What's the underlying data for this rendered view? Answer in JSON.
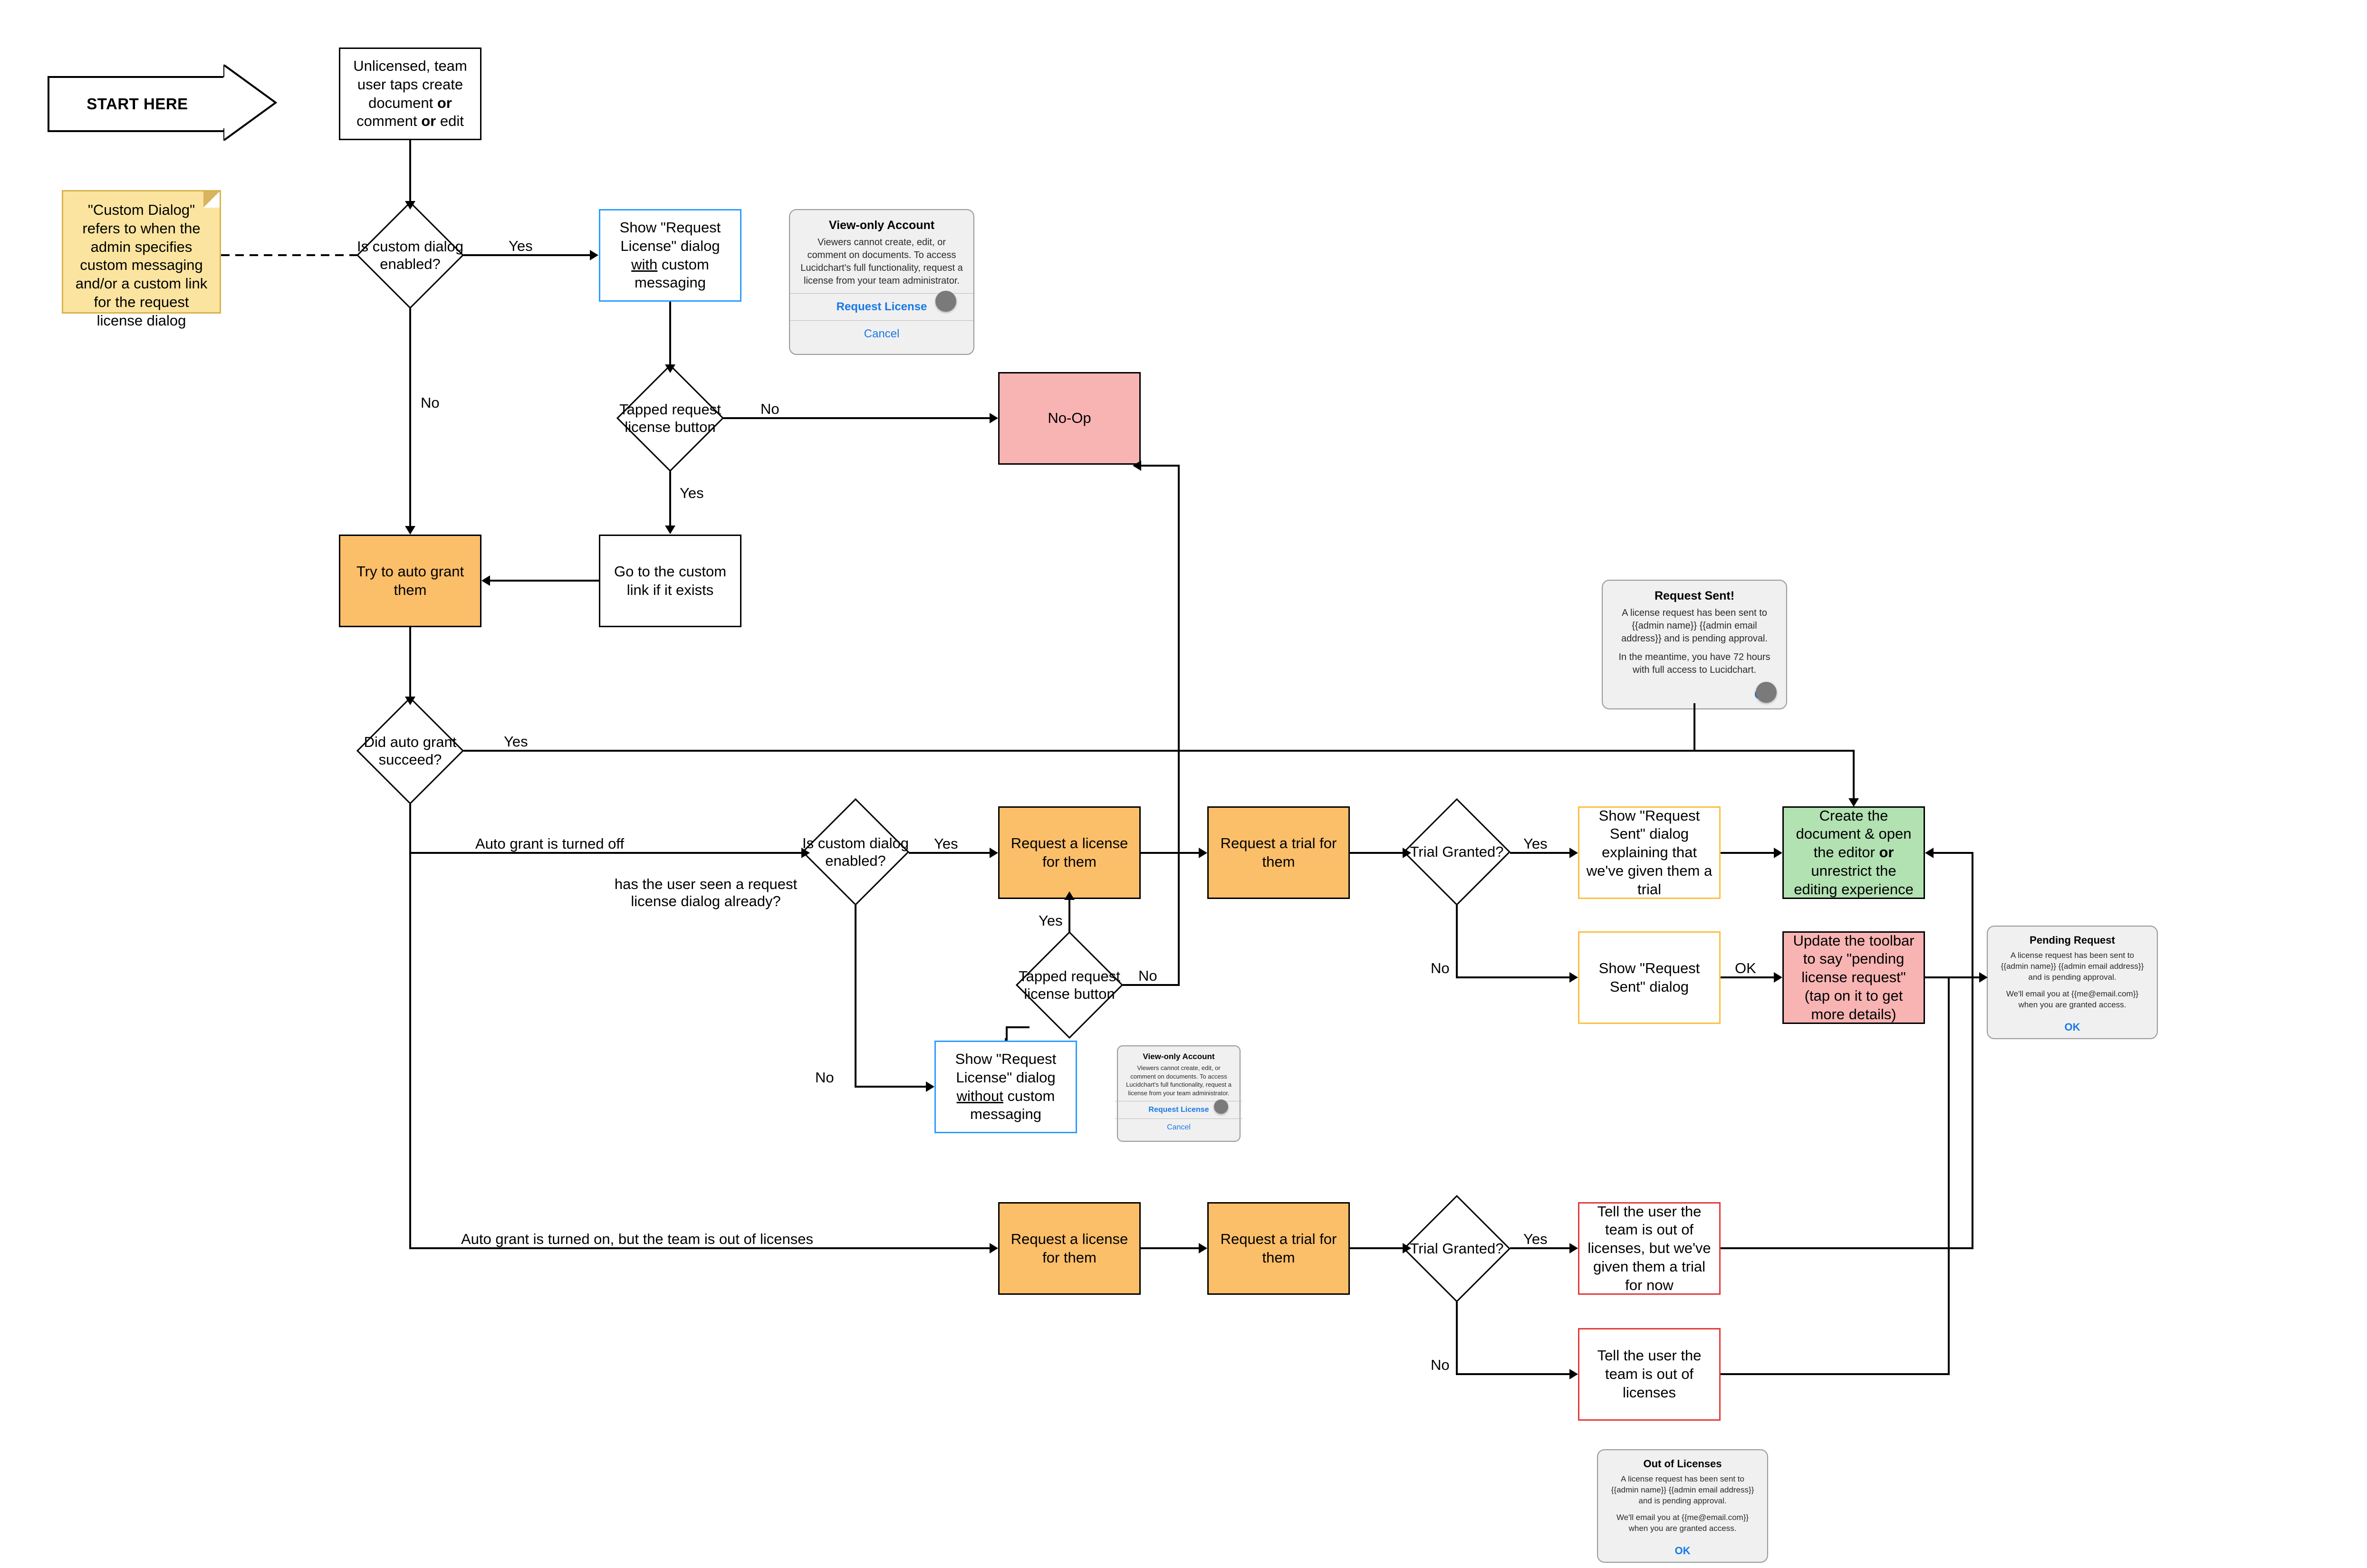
{
  "start": "START HERE",
  "note": "\"Custom Dialog\" refers to when the admin specifies custom messaging and/or a custom link for the request license dialog",
  "nodes": {
    "n_start_evt": "Unlicensed, team user taps create document __or__ comment __or__ edit",
    "d_custom1": "Is custom dialog enabled?",
    "n_show_with": "Show \"Request License\" dialog __with__ custom messaging",
    "d_tap1": "Tapped request license button",
    "n_noop": "No-Op",
    "n_goto_link": "Go to the custom link if it exists",
    "n_try_auto": "Try to auto grant them",
    "d_auto_succeed": "Did auto grant succeed?",
    "d_custom2": "Is custom dialog enabled?",
    "q_seen": "has the user seen a request license dialog already?",
    "n_req_lic_1": "Request a license for them",
    "n_req_trial_1": "Request a trial for them",
    "d_trial1": "Trial Granted?",
    "n_sent_trial": "Show \"Request Sent\" dialog explaining that we've given them a trial",
    "n_sent_plain": "Show \"Request Sent\" dialog",
    "d_tap2": "Tapped request license button",
    "n_show_without": "Show \"Request License\" dialog __without__ custom messaging",
    "n_req_lic_2": "Request a license for them",
    "n_req_trial_2": "Request a trial for them",
    "d_trial2": "Trial Granted?",
    "n_out_trial": "Tell the user the team is out of licenses, but we've given them a trial for now",
    "n_out_plain": "Tell the user the team is out of licenses",
    "n_create": "Create the document & open the editor __or__ unrestrict the editing experience",
    "n_update_tb": "Update the toolbar to say \"pending license request\" (tap on it to get more details)"
  },
  "labels": {
    "yes": "Yes",
    "no": "No",
    "ok": "OK",
    "auto_off": "Auto grant is turned off",
    "auto_on_out": "Auto grant is turned on, but the team is out of licenses"
  },
  "dialogs": {
    "viewonly": {
      "title": "View-only Account",
      "body": "Viewers cannot create, edit, or comment on documents. To access Lucidchart's full functionality, request a license from your team administrator.",
      "primary": "Request License",
      "secondary": "Cancel"
    },
    "req_sent": {
      "title": "Request Sent!",
      "body1": "A license request has been sent to {{admin name}} {{admin email address}} and is pending approval.",
      "body2": "In the meantime, you have 72 hours with full access to Lucidchart.",
      "ok": "OK"
    },
    "pending": {
      "title": "Pending Request",
      "body1": "A license request has been sent to {{admin name}} {{admin email address}} and is pending approval.",
      "body2": "We'll email you at {{me@email.com}} when you are granted access.",
      "ok": "OK"
    },
    "outlic": {
      "title": "Out of Licenses",
      "body1": "A license request has been sent to {{admin name}} {{admin email address}} and is pending approval.",
      "body2": "We'll email you at {{me@email.com}} when you are granted access.",
      "ok": "OK"
    }
  },
  "chart_data": {
    "type": "flowchart",
    "nodes": [
      {
        "id": "start_evt",
        "kind": "process",
        "label": "Unlicensed, team user taps create document or comment or edit"
      },
      {
        "id": "d_custom1",
        "kind": "decision",
        "label": "Is custom dialog enabled?"
      },
      {
        "id": "show_with",
        "kind": "process",
        "style": "blue",
        "label": "Show \"Request License\" dialog with custom messaging"
      },
      {
        "id": "d_tap1",
        "kind": "decision",
        "label": "Tapped request license button"
      },
      {
        "id": "noop",
        "kind": "terminal",
        "style": "pink",
        "label": "No-Op"
      },
      {
        "id": "goto_link",
        "kind": "process",
        "label": "Go to the custom link if it exists"
      },
      {
        "id": "try_auto",
        "kind": "process",
        "style": "orange",
        "label": "Try to auto grant them"
      },
      {
        "id": "d_auto",
        "kind": "decision",
        "label": "Did auto grant succeed?"
      },
      {
        "id": "d_custom2",
        "kind": "decision",
        "label": "Is custom dialog enabled?"
      },
      {
        "id": "req_lic_1",
        "kind": "process",
        "style": "orange",
        "label": "Request a license for them"
      },
      {
        "id": "req_trial_1",
        "kind": "process",
        "style": "orange",
        "label": "Request a trial for them"
      },
      {
        "id": "d_trial1",
        "kind": "decision",
        "label": "Trial Granted?"
      },
      {
        "id": "sent_trial",
        "kind": "process",
        "style": "outline-yellow",
        "label": "Show \"Request Sent\" dialog explaining that we've given them a trial"
      },
      {
        "id": "sent_plain",
        "kind": "process",
        "style": "outline-yellow",
        "label": "Show \"Request Sent\" dialog"
      },
      {
        "id": "d_tap2",
        "kind": "decision",
        "label": "Tapped request license button"
      },
      {
        "id": "show_without",
        "kind": "process",
        "style": "blue",
        "label": "Show \"Request License\" dialog without custom messaging"
      },
      {
        "id": "req_lic_2",
        "kind": "process",
        "style": "orange",
        "label": "Request a license for them"
      },
      {
        "id": "req_trial_2",
        "kind": "process",
        "style": "orange",
        "label": "Request a trial for them"
      },
      {
        "id": "d_trial2",
        "kind": "decision",
        "label": "Trial Granted?"
      },
      {
        "id": "out_trial",
        "kind": "process",
        "style": "outline-red",
        "label": "Tell the user the team is out of licenses, but we've given them a trial for now"
      },
      {
        "id": "out_plain",
        "kind": "process",
        "style": "outline-red",
        "label": "Tell the user the team is out of licenses"
      },
      {
        "id": "create",
        "kind": "terminal",
        "style": "green",
        "label": "Create the document & open the editor or unrestrict the editing experience"
      },
      {
        "id": "update_tb",
        "kind": "terminal",
        "style": "pink",
        "label": "Update the toolbar to say \"pending license request\" (tap on it to get more details)"
      }
    ],
    "edges": [
      {
        "from": "start_evt",
        "to": "d_custom1"
      },
      {
        "from": "d_custom1",
        "to": "show_with",
        "label": "Yes"
      },
      {
        "from": "d_custom1",
        "to": "try_auto",
        "label": "No"
      },
      {
        "from": "show_with",
        "to": "d_tap1"
      },
      {
        "from": "d_tap1",
        "to": "noop",
        "label": "No"
      },
      {
        "from": "d_tap1",
        "to": "goto_link",
        "label": "Yes"
      },
      {
        "from": "goto_link",
        "to": "try_auto"
      },
      {
        "from": "try_auto",
        "to": "d_auto"
      },
      {
        "from": "d_auto",
        "to": "create",
        "label": "Yes"
      },
      {
        "from": "d_auto",
        "to": "d_custom2",
        "label": "Auto grant is turned off"
      },
      {
        "from": "d_auto",
        "to": "req_lic_2",
        "label": "Auto grant is turned on, but the team is out of licenses"
      },
      {
        "from": "d_custom2",
        "to": "req_lic_1",
        "label": "Yes"
      },
      {
        "from": "d_custom2",
        "to": "show_without",
        "label": "No"
      },
      {
        "from": "show_without",
        "to": "d_tap2"
      },
      {
        "from": "d_tap2",
        "to": "req_lic_1",
        "label": "Yes"
      },
      {
        "from": "d_tap2",
        "to": "noop",
        "label": "No"
      },
      {
        "from": "req_lic_1",
        "to": "req_trial_1"
      },
      {
        "from": "req_trial_1",
        "to": "d_trial1"
      },
      {
        "from": "d_trial1",
        "to": "sent_trial",
        "label": "Yes"
      },
      {
        "from": "d_trial1",
        "to": "sent_plain",
        "label": "No"
      },
      {
        "from": "sent_trial",
        "to": "create"
      },
      {
        "from": "sent_plain",
        "to": "update_tb",
        "label": "OK"
      },
      {
        "from": "req_lic_2",
        "to": "req_trial_2"
      },
      {
        "from": "req_trial_2",
        "to": "d_trial2"
      },
      {
        "from": "d_trial2",
        "to": "out_trial",
        "label": "Yes"
      },
      {
        "from": "d_trial2",
        "to": "out_plain",
        "label": "No"
      },
      {
        "from": "out_trial",
        "to": "create"
      },
      {
        "from": "out_plain",
        "to": "update_tb"
      }
    ],
    "annotations": [
      {
        "kind": "note",
        "text": "\"Custom Dialog\" refers to when the admin specifies custom messaging and/or a custom link for the request license dialog",
        "attached_to": "d_custom1"
      },
      {
        "kind": "text",
        "text": "has the user seen a request license dialog already?",
        "near": "d_custom2"
      },
      {
        "kind": "ui-mock",
        "ref": "viewonly",
        "near": "show_with"
      },
      {
        "kind": "ui-mock",
        "ref": "viewonly",
        "near": "show_without"
      },
      {
        "kind": "ui-mock",
        "ref": "req_sent",
        "near": "create"
      },
      {
        "kind": "ui-mock",
        "ref": "pending",
        "near": "update_tb"
      },
      {
        "kind": "ui-mock",
        "ref": "outlic",
        "near": "out_plain"
      }
    ]
  }
}
